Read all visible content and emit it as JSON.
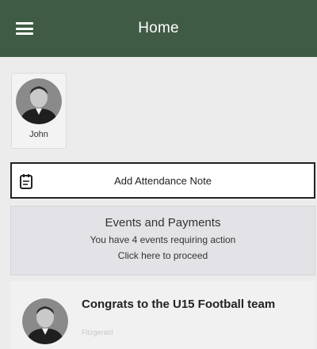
{
  "header": {
    "title": "Home",
    "menu_icon": "hamburger-menu-icon"
  },
  "profile": {
    "name": "John",
    "avatar_icon": "user-avatar-icon"
  },
  "attendance": {
    "label": "Add Attendance Note",
    "icon": "notepad-icon"
  },
  "events": {
    "title": "Events and Payments",
    "line1": "You have 4 events requiring action",
    "line2": "Click here to proceed"
  },
  "news": {
    "title": "Congrats to the U15 Football team",
    "subtitle": "Fitzgerald",
    "avatar_icon": "user-avatar-icon"
  },
  "colors": {
    "header_bg": "#3f5b45",
    "page_bg": "#ececec"
  }
}
